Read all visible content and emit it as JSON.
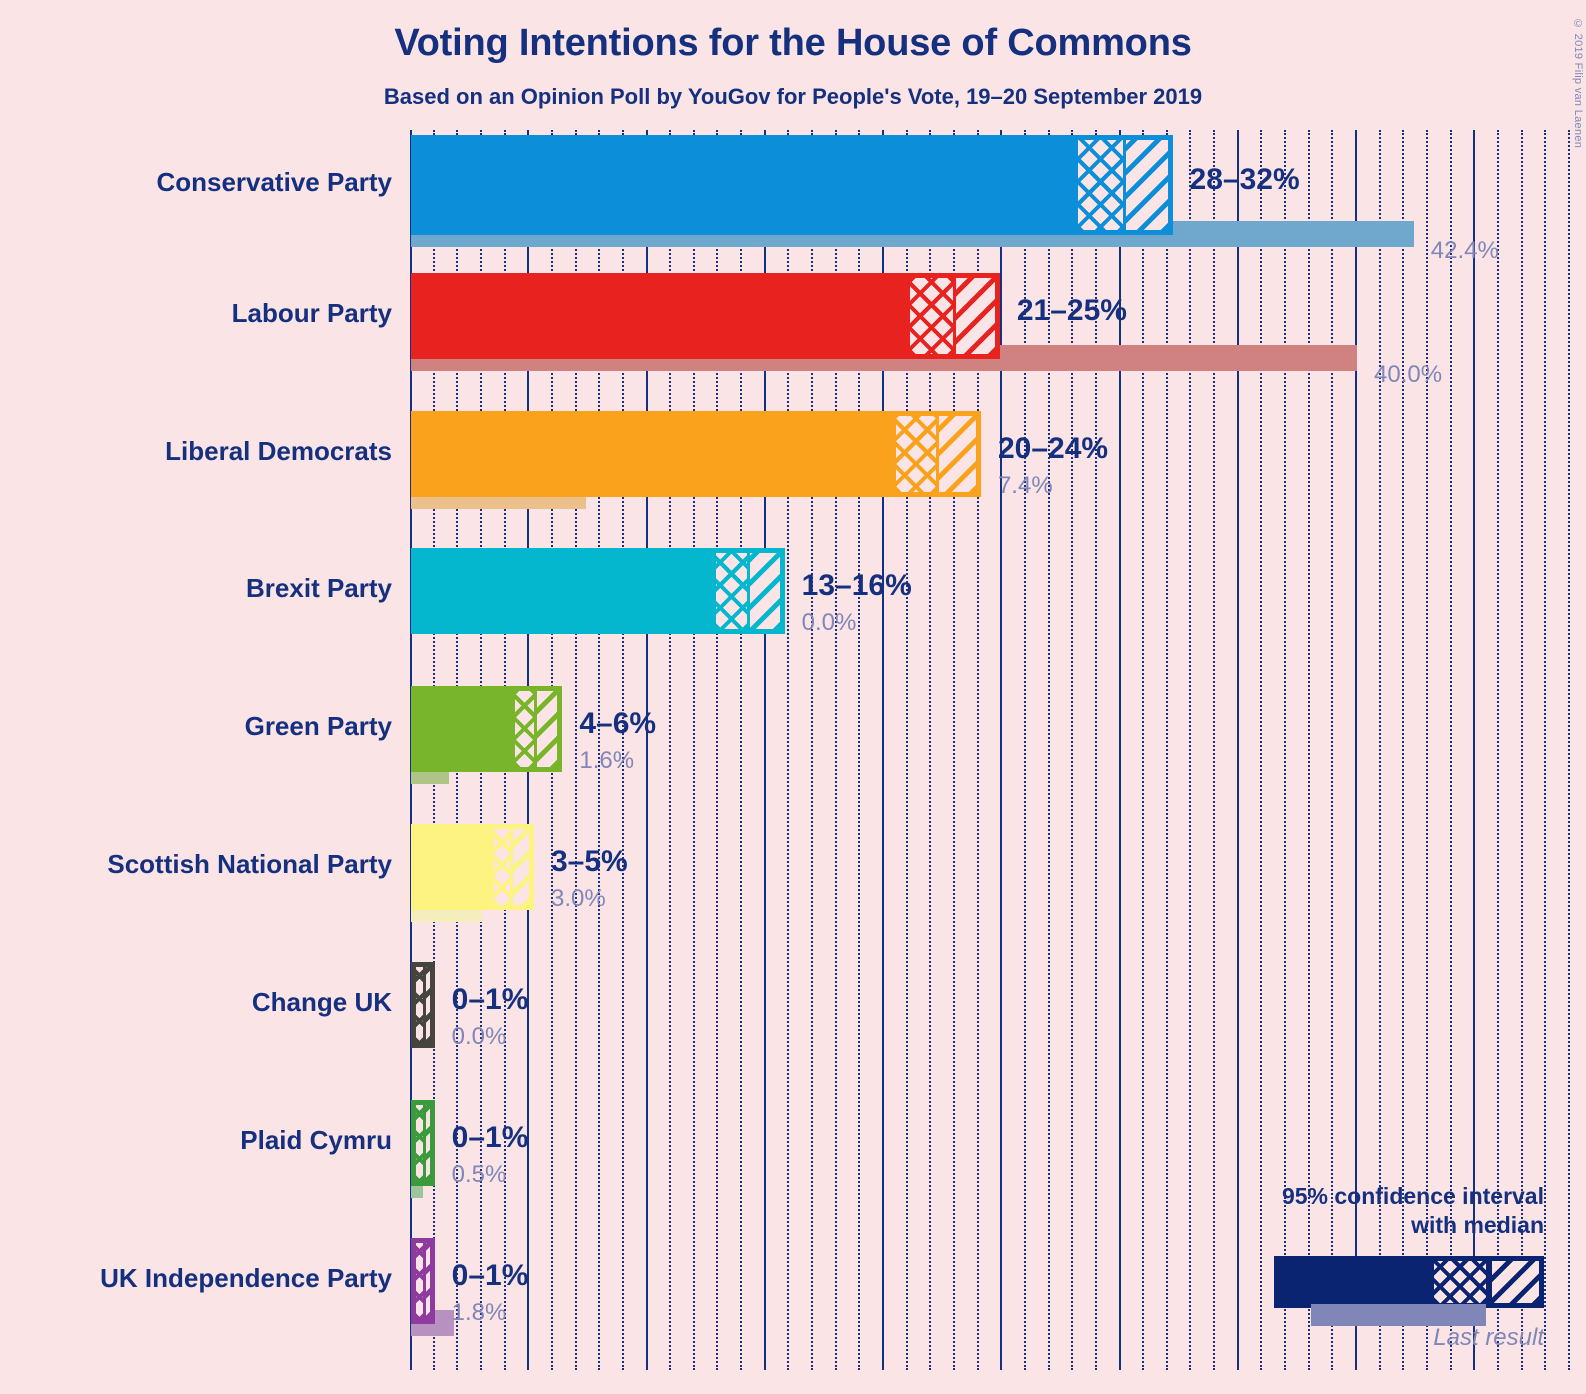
{
  "header": {
    "title": "Voting Intentions for the House of Commons",
    "subtitle": "Based on an Opinion Poll by YouGov for People's Vote, 19–20 September 2019",
    "copyright": "© 2019 Filip van Laenen"
  },
  "legend": {
    "line1": "95% confidence interval",
    "line2": "with median",
    "last_result_label": "Last result",
    "swatch_color": "#0A2472",
    "last_result_color": "#8087B8"
  },
  "axis": {
    "min": 0,
    "max": 49,
    "major_step": 5,
    "minor_step": 1,
    "unit": "%"
  },
  "chart_data": {
    "type": "bar",
    "title": "Voting Intentions for the House of Commons",
    "subtitle": "Based on an Opinion Poll by YouGov for People's Vote, 19–20 September 2019",
    "xlabel": "",
    "ylabel": "",
    "xlim": [
      0,
      49
    ],
    "grid": true,
    "legend_position": "bottom-right",
    "value_unit": "%",
    "series_notes": "Each party shows a 95% confidence interval with median, plus the last election result.",
    "categories": [
      "Conservative Party",
      "Labour Party",
      "Liberal Democrats",
      "Brexit Party",
      "Green Party",
      "Scottish National Party",
      "Change UK",
      "Plaid Cymru",
      "UK Independence Party"
    ],
    "parties": [
      {
        "name": "Conservative Party",
        "ci_label": "28–32%",
        "ci_low": 28.0,
        "ci_high": 32.2,
        "median": 30.1,
        "last_result": 42.4,
        "last_result_label": "42.4%",
        "color": "#0C8FD8",
        "last_color": "#6FA8CC"
      },
      {
        "name": "Labour Party",
        "ci_label": "21–25%",
        "ci_low": 20.9,
        "ci_high": 24.9,
        "median": 22.9,
        "last_result": 40.0,
        "last_result_label": "40.0%",
        "color": "#E8221E",
        "last_color": "#D08281"
      },
      {
        "name": "Liberal Democrats",
        "ci_label": "20–24%",
        "ci_low": 20.3,
        "ci_high": 24.1,
        "median": 22.2,
        "last_result": 7.4,
        "last_result_label": "7.4%",
        "color": "#FAA21B",
        "last_color": "#ECC08A"
      },
      {
        "name": "Brexit Party",
        "ci_label": "13–16%",
        "ci_low": 12.7,
        "ci_high": 15.8,
        "median": 14.2,
        "last_result": 0.0,
        "last_result_label": "0.0%",
        "color": "#04B7CE",
        "last_color": "#8FC9D2"
      },
      {
        "name": "Green Party",
        "ci_label": "4–6%",
        "ci_low": 4.2,
        "ci_high": 6.4,
        "median": 5.2,
        "last_result": 1.6,
        "last_result_label": "1.6%",
        "color": "#79B52B",
        "last_color": "#AEC587"
      },
      {
        "name": "Scottish National Party",
        "ci_label": "3–5%",
        "ci_low": 3.3,
        "ci_high": 5.2,
        "median": 4.2,
        "last_result": 3.0,
        "last_result_label": "3.0%",
        "color": "#FCF380",
        "last_color": "#F4EDBC"
      },
      {
        "name": "Change UK",
        "ci_label": "0–1%",
        "ci_low": 0.0,
        "ci_high": 1.0,
        "median": 0.5,
        "last_result": 0.0,
        "last_result_label": "0.0%",
        "color": "#45443F",
        "last_color": "#9B9B93"
      },
      {
        "name": "Plaid Cymru",
        "ci_label": "0–1%",
        "ci_low": 0.0,
        "ci_high": 1.0,
        "median": 0.5,
        "last_result": 0.5,
        "last_result_label": "0.5%",
        "color": "#3B9B3B",
        "last_color": "#9DC49D"
      },
      {
        "name": "UK Independence Party",
        "ci_label": "0–1%",
        "ci_low": 0.0,
        "ci_high": 1.0,
        "median": 0.5,
        "last_result": 1.8,
        "last_result_label": "1.8%",
        "color": "#8F3A9E",
        "last_color": "#B792C0"
      }
    ]
  }
}
